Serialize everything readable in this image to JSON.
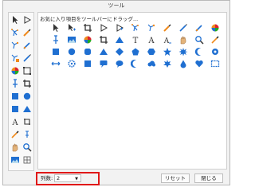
{
  "dialog": {
    "title": "ツール"
  },
  "panel": {
    "hint": "お気に入り項目をツールバーにドラッグ..."
  },
  "left_column_icons": [
    "tool-marker-icon",
    "play-outline-icon",
    "pose-icon",
    "brush-icon",
    "pose-edit-icon",
    "brush-small-icon",
    "pose-select-icon",
    "pen-icon",
    "color-wheel-icon",
    "transform-icon",
    "pin-icon",
    "crop-icon",
    "square-blue-icon",
    "circle-blue-icon",
    "square-blue-icon",
    "triangle-blue-icon",
    "text-a-icon",
    "crop-small-icon",
    "pipette-icon",
    "pin-small-icon",
    "hand-icon",
    "magnify-icon",
    "landscape-icon",
    "grid-icon"
  ],
  "main_icons": [
    [
      "cursor-icon",
      "cursor-plus-icon",
      "crop-icon",
      "play-outline-icon",
      "play-filled-icon",
      "pose-icon",
      "pose-edit-icon",
      "brush-icon",
      "pen-icon",
      "brush-small-icon",
      "color-wheel-icon"
    ],
    [
      "pin-icon",
      "landscape-icon",
      "color-wheel-icon",
      "crop-icon",
      "triangle-blue-icon",
      "text-t-icon",
      "text-a-icon",
      "text-a-small-icon",
      "hand-icon",
      "magnify-icon",
      "pipette-icon"
    ],
    [
      "square-blue-icon",
      "circle-blue-icon",
      "rounded-square-icon",
      "triangle-blue-icon",
      "diamond-icon",
      "pentagon-icon",
      "hexagon-icon",
      "star-icon",
      "burst-icon",
      "crescent-icon",
      "gear-icon"
    ],
    [
      "arrows-icon",
      "gear-small-icon",
      "square-blue-icon",
      "speech-bubble-icon",
      "speech-bubble-round-icon",
      "crescent-left-icon",
      "cloud-icon",
      "splash-icon",
      "drop-icon",
      "heart-icon",
      "frame-icon"
    ]
  ],
  "footer": {
    "columns_label": "列数:",
    "columns_value": "2",
    "reset_label": "リセット",
    "close_label": "閉じる"
  },
  "colors": {
    "icon_blue": "#1f6fd1",
    "icon_orange": "#f08a1c",
    "highlight": "#e01818"
  }
}
